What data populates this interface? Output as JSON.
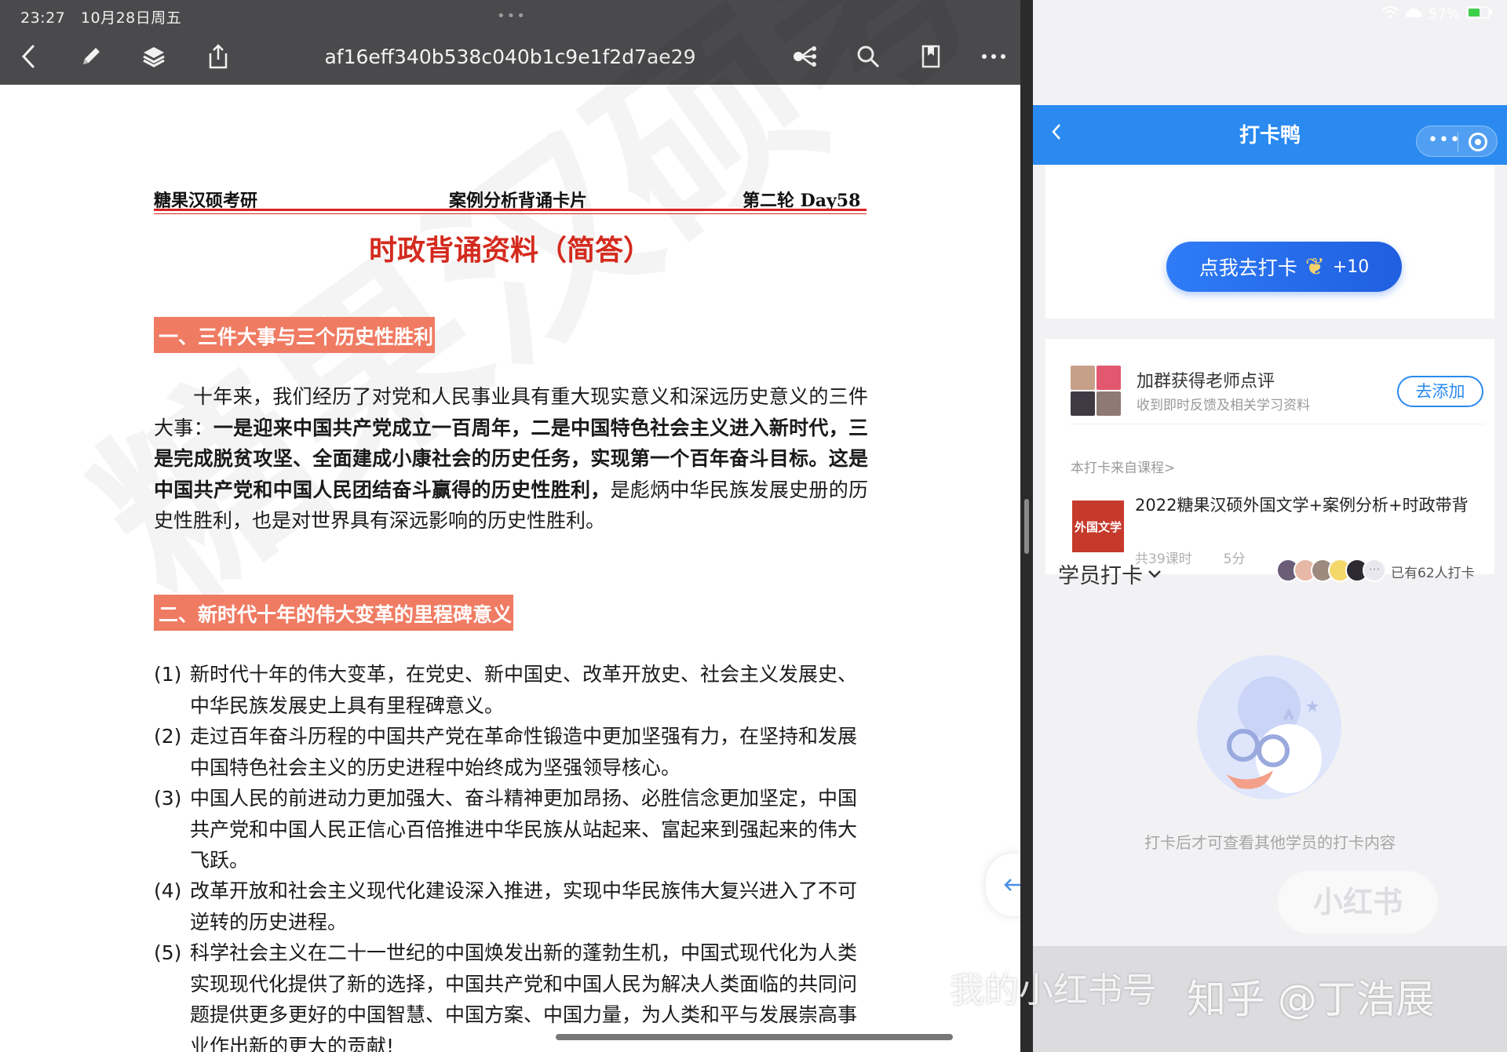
{
  "status": {
    "time": "23:27",
    "date": "10月28日周五",
    "battery": "57%"
  },
  "toolbar": {
    "doc_title": "af16eff340b538c040b1c9e1f2d7ae29"
  },
  "pdf": {
    "header_left": "糖果汉硕考研",
    "header_center": "案例分析背诵卡片",
    "header_right": "第二轮 Day58",
    "main_title": "时政背诵资料（简答）",
    "watermark": "糖果汉硕考研",
    "section1_title": "一、三件大事与三个历史性胜利",
    "section1_para_pre": "十年来，我们经历了对党和人民事业具有重大现实意义和深远历史意义的三件大事：",
    "section1_para_bold": "一是迎来中国共产党成立一百周年，二是中国特色社会主义进入新时代，三是完成脱贫攻坚、全面建成小康社会的历史任务，实现第一个百年奋斗目标。这是中国共产党和中国人民团结奋斗赢得的历史性胜利，",
    "section1_para_post": "是彪炳中华民族发展史册的历史性胜利，也是对世界具有深远影响的历史性胜利。",
    "section2_title": "二、新时代十年的伟大变革的里程碑意义",
    "items": [
      {
        "num": "(1)",
        "text": "新时代十年的伟大变革，在党史、新中国史、改革开放史、社会主义发展史、中华民族发展史上具有里程碑意义。"
      },
      {
        "num": "(2)",
        "text": "走过百年奋斗历程的中国共产党在革命性锻造中更加坚强有力，在坚持和发展中国特色社会主义的历史进程中始终成为坚强领导核心。"
      },
      {
        "num": "(3)",
        "text": "中国人民的前进动力更加强大、奋斗精神更加昂扬、必胜信念更加坚定，中国共产党和中国人民正信心百倍推进中华民族从站起来、富起来到强起来的伟大飞跃。"
      },
      {
        "num": "(4)",
        "text": "改革开放和社会主义现代化建设深入推进，实现中华民族伟大复兴进入了不可逆转的历史进程。"
      },
      {
        "num": "(5)",
        "text": "科学社会主义在二十一世纪的中国焕发出新的蓬勃生机，中国式现代化为人类实现现代化提供了新的选择，中国共产党和中国人民为解决人类面临的共同问题提供更多更好的中国智慧、中国方案、中国力量，为人类和平与发展崇高事业作出新的更大的贡献!"
      }
    ]
  },
  "miniapp": {
    "title": "打卡鸭",
    "checkin_label": "点我去打卡",
    "checkin_bonus": "+10",
    "group_title": "加群获得老师点评",
    "group_subtitle": "收到即时反馈及相关学习资料",
    "add_label": "去添加",
    "source_label": "本打卡来自课程>",
    "course_thumb_text": "外国文学",
    "course_title": "2022糖果汉硕外国文学+案例分析+时政带背",
    "course_lessons": "共39课时",
    "course_duration": "5分",
    "students_label": "学员打卡",
    "more_avatars": "···",
    "joined_count": "已有62人打卡",
    "empty_text": "打卡后才可查看其他学员的打卡内容",
    "xhs_badge": "小红书"
  },
  "footer": {
    "watermark_left": "我的小红书号",
    "watermark_right": "知乎 @丁浩展"
  }
}
